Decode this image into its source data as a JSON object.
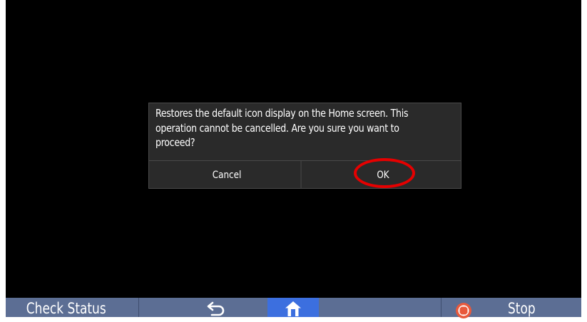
{
  "dialog": {
    "message": "Restores the default icon display on the Home screen. This operation cannot be cancelled. Are you sure you want to proceed?",
    "cancel_label": "Cancel",
    "ok_label": "OK"
  },
  "taskbar": {
    "check_status_label": "Check Status",
    "back_icon": "back-arrow-icon",
    "home_icon": "home-icon",
    "stop_icon": "stop-icon",
    "stop_label": "Stop"
  },
  "colors": {
    "screen_bg": "#000000",
    "dialog_bg": "#2a2a2a",
    "taskbar_bg": "#5c6e94",
    "home_active": "#3c6fdf",
    "highlight": "#e60000",
    "stop_accent": "#e8593c"
  }
}
